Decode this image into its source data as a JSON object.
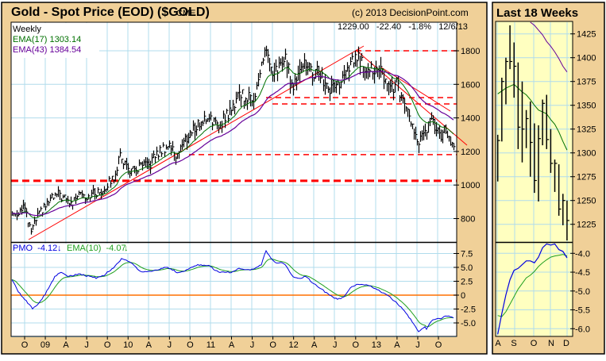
{
  "header": {
    "title": "Gold - Spot Price (EOD) ($GOLD)",
    "exchange": "CME",
    "copyright": "(c) 2013 DecisionPoint.com",
    "last_quote": "1229.00   -22.40   -1.8%   12/6/13"
  },
  "legend": {
    "period": "Weekly",
    "ema17": "EMA(17) 1303.14",
    "ema43": "EMA(43) 1384.54",
    "pmo": "PMO  -4.12",
    "pmo_ema": "EMA(10)  -4.07"
  },
  "inset": {
    "title": "Last 18 Weeks"
  },
  "colors": {
    "panel": "#F0D098",
    "inset_bg": "#FFFFC0",
    "grid": "#B0DCEC",
    "ema17": "#007000",
    "ema43": "#660099",
    "pmo": "#0000E0",
    "pmo_ema": "#20A020",
    "trend": "#FF0000",
    "zero": "#FF7000"
  },
  "chart_data": [
    {
      "type": "line",
      "title": "Gold - Spot Price (EOD) ($GOLD) weekly bars",
      "ylim": [
        640,
        1970
      ],
      "y_ticks": [
        "1800",
        "1600",
        "1400",
        "1200",
        "1000",
        "800"
      ],
      "x_ticks": [
        "O",
        "09",
        "A",
        "J",
        "O",
        "10",
        "A",
        "J",
        "O",
        "11",
        "A",
        "J",
        "O",
        "12",
        "A",
        "J",
        "O",
        "13",
        "A",
        "J",
        "O"
      ],
      "monthly_closes_from_aug_2008": [
        830,
        880,
        720,
        815,
        870,
        920,
        945,
        915,
        885,
        975,
        930,
        950,
        955,
        1000,
        1045,
        1180,
        1100,
        1080,
        1115,
        1110,
        1175,
        1210,
        1245,
        1180,
        1245,
        1305,
        1355,
        1385,
        1420,
        1335,
        1410,
        1435,
        1555,
        1535,
        1500,
        1625,
        1830,
        1620,
        1720,
        1745,
        1565,
        1740,
        1710,
        1665,
        1665,
        1560,
        1600,
        1610,
        1690,
        1775,
        1720,
        1715,
        1675,
        1665,
        1580,
        1595,
        1470,
        1390,
        1235,
        1315,
        1395,
        1325,
        1325,
        1250,
        1229
      ],
      "support_resistance_levels": [
        1800,
        1521,
        1483,
        1181,
        1025
      ],
      "pmo": {
        "ylim": [
          -7.2,
          9.5
        ],
        "y_ticks": [
          "7.5",
          "5.0",
          "2.5",
          "0",
          "-2.5",
          "-5.0"
        ],
        "points_week_value": [
          [
            0,
            2.9
          ],
          [
            4,
            0.6
          ],
          [
            13,
            -2.4
          ],
          [
            17,
            -1.4
          ],
          [
            21,
            0.2
          ],
          [
            27,
            3.3
          ],
          [
            31,
            4.1
          ],
          [
            35,
            3.3
          ],
          [
            42,
            3.8
          ],
          [
            50,
            3.3
          ],
          [
            53,
            3.1
          ],
          [
            58,
            3.6
          ],
          [
            64,
            5.0
          ],
          [
            69,
            6.5
          ],
          [
            75,
            5.9
          ],
          [
            80,
            4.4
          ],
          [
            85,
            4.1
          ],
          [
            92,
            4.6
          ],
          [
            97,
            5.1
          ],
          [
            105,
            4.0
          ],
          [
            111,
            4.7
          ],
          [
            117,
            5.4
          ],
          [
            124,
            5.3
          ],
          [
            130,
            4.1
          ],
          [
            138,
            4.1
          ],
          [
            143,
            4.8
          ],
          [
            151,
            4.6
          ],
          [
            157,
            5.5
          ],
          [
            160,
            8.0
          ],
          [
            165,
            6.0
          ],
          [
            172,
            5.6
          ],
          [
            177,
            3.3
          ],
          [
            181,
            2.9
          ],
          [
            185,
            3.4
          ],
          [
            189,
            2.3
          ],
          [
            195,
            1.1
          ],
          [
            200,
            -0.1
          ],
          [
            205,
            -0.7
          ],
          [
            209,
            -0.4
          ],
          [
            214,
            1.6
          ],
          [
            218,
            2.0
          ],
          [
            225,
            1.8
          ],
          [
            230,
            1.0
          ],
          [
            236,
            0.1
          ],
          [
            241,
            -1.1
          ],
          [
            246,
            -2.5
          ],
          [
            251,
            -4.4
          ],
          [
            256,
            -6.5
          ],
          [
            259,
            -6.0
          ],
          [
            264,
            -4.5
          ],
          [
            269,
            -4.1
          ],
          [
            274,
            -3.8
          ],
          [
            278,
            -4.12
          ]
        ]
      }
    },
    {
      "type": "line",
      "title": "Last 18 Weeks",
      "ylim": [
        1205,
        1437
      ],
      "y_ticks": [
        "1425",
        "1400",
        "1375",
        "1350",
        "1325",
        "1300",
        "1275",
        "1250",
        "1225"
      ],
      "x_ticks": [
        "A",
        "S",
        "O",
        "N",
        "D"
      ],
      "high": [
        1319,
        1379,
        1400,
        1434,
        1416,
        1395,
        1375,
        1345,
        1354,
        1331,
        1329,
        1356,
        1361,
        1325,
        1293,
        1288,
        1257,
        1250
      ],
      "low": [
        1270,
        1312,
        1351,
        1388,
        1358,
        1304,
        1290,
        1305,
        1275,
        1258,
        1249,
        1308,
        1304,
        1279,
        1259,
        1234,
        1224,
        1208
      ],
      "close": [
        1313,
        1375,
        1396,
        1396,
        1391,
        1327,
        1325,
        1336,
        1311,
        1271,
        1315,
        1352,
        1314,
        1289,
        1289,
        1241,
        1250,
        1229
      ],
      "ema17": [
        1362,
        1365,
        1368,
        1370,
        1372,
        1368,
        1364,
        1361,
        1356,
        1350,
        1345,
        1343,
        1341,
        1335,
        1330,
        1322,
        1312,
        1303
      ],
      "ema43": [
        null,
        null,
        null,
        null,
        null,
        null,
        null,
        null,
        1438,
        1434,
        1429,
        1424,
        1417,
        1412,
        1406,
        1399,
        1391,
        1385
      ],
      "pmo": {
        "ylim": [
          -6.2,
          -3.7
        ],
        "y_ticks": [
          "-4.0",
          "-4.5",
          "-5.0",
          "-5.5",
          "-6.0"
        ],
        "pmo": [
          -6.15,
          -5.6,
          -5.1,
          -4.7,
          -4.45,
          -4.4,
          -4.3,
          -4.2,
          -4.2,
          -4.25,
          -4.1,
          -3.85,
          -3.75,
          -3.78,
          -3.75,
          -3.9,
          -3.95,
          -4.12
        ],
        "pmo_ema": [
          -5.65,
          -5.68,
          -5.55,
          -5.35,
          -5.15,
          -4.95,
          -4.8,
          -4.65,
          -4.58,
          -4.48,
          -4.35,
          -4.25,
          -4.17,
          -4.1,
          -4.07,
          -4.05,
          -4.03,
          -4.07
        ]
      }
    }
  ]
}
